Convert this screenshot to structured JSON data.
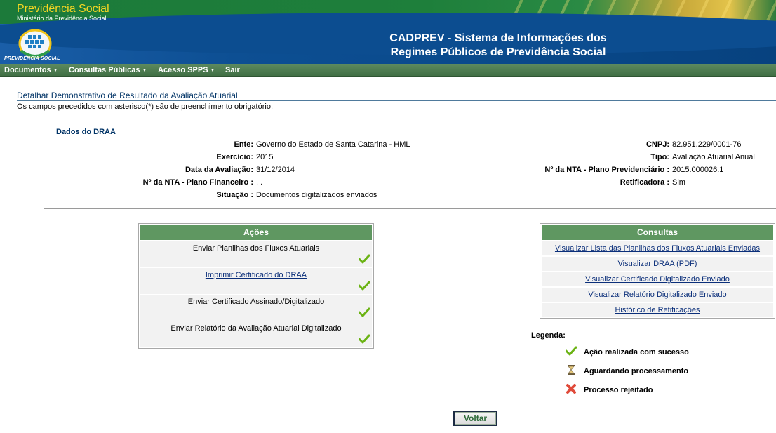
{
  "header": {
    "brand_title": "Previdência Social",
    "brand_sub": "Ministério da Previdência Social",
    "logo_label": "PREVIDÊNCIA SOCIAL",
    "system_title_line1": "CADPREV - Sistema de Informações dos",
    "system_title_line2": "Regimes Públicos de Previdência Social"
  },
  "menu": [
    {
      "label": "Documentos",
      "caret": "▼"
    },
    {
      "label": "Consultas Públicas",
      "caret": "▼"
    },
    {
      "label": "Acesso SPPS",
      "caret": "▼"
    },
    {
      "label": "Sair",
      "caret": ""
    }
  ],
  "page": {
    "title": "Detalhar Demonstrativo de Resultado da Avaliação Atuarial",
    "required_note": "Os campos precedidos com asterisco(*) são de preenchimento obrigatório."
  },
  "draa": {
    "legend": "Dados do DRAA",
    "left": [
      {
        "label": "Ente:",
        "value": "Governo do Estado de Santa Catarina - HML"
      },
      {
        "label": "Exercício:",
        "value": "2015"
      },
      {
        "label": "Data da Avaliação:",
        "value": "31/12/2014"
      },
      {
        "label": "Nº da NTA - Plano Financeiro :",
        "value": ". ."
      },
      {
        "label": "Situação :",
        "value": "Documentos digitalizados enviados"
      }
    ],
    "right": [
      {
        "label": "CNPJ:",
        "value": "82.951.229/0001-76"
      },
      {
        "label": "Tipo:",
        "value": "Avaliação Atuarial Anual"
      },
      {
        "label": "Nº da NTA - Plano Previdenciário :",
        "value": "2015.000026.1"
      },
      {
        "label": "Retificadora :",
        "value": "Sim"
      }
    ]
  },
  "acoes": {
    "header": "Ações",
    "items": [
      {
        "label": "Enviar Planilhas dos Fluxos Atuariais",
        "status": "success"
      },
      {
        "label": "Imprimir Certificado do DRAA",
        "status": "success"
      },
      {
        "label": "Enviar Certificado Assinado/Digitalizado",
        "status": "success"
      },
      {
        "label": "Enviar Relatório da Avaliação Atuarial Digitalizado",
        "status": "success"
      }
    ]
  },
  "consultas": {
    "header": "Consultas",
    "items": [
      "Visualizar Lista das Planilhas dos Fluxos Atuariais Enviadas",
      "Visualizar DRAA (PDF)",
      "Visualizar Certificado Digitalizado Enviado",
      "Visualizar Relatório Digitalizado Enviado",
      "Histórico de Retificações"
    ]
  },
  "legenda": {
    "title": "Legenda:",
    "items": [
      {
        "icon": "check-icon",
        "label": "Ação realizada com sucesso"
      },
      {
        "icon": "hourglass-icon",
        "label": "Aguardando processamento"
      },
      {
        "icon": "red-x-icon",
        "label": "Processo rejeitado"
      }
    ]
  },
  "buttons": {
    "voltar": "Voltar"
  },
  "colors": {
    "header_blue": "#0c4d90",
    "menu_green": "#4a784d",
    "panel_green": "#5f9761",
    "title_blue": "#003366",
    "link_blue": "#0b2f7a",
    "brand_yellow": "#f5d623"
  }
}
